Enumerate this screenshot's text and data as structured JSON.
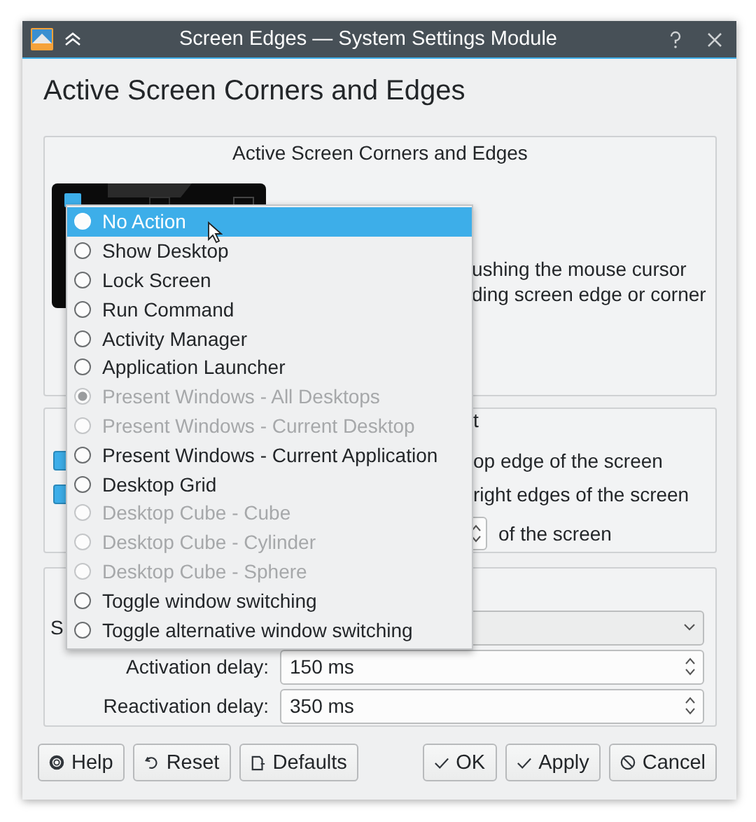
{
  "window": {
    "title": "Screen Edges — System Settings Module"
  },
  "heading": "Active Screen Corners and Edges",
  "edges_group": {
    "title": "Active Screen Corners and Edges",
    "description_lines": [
      "ushing the mouse cursor",
      "ding screen edge or corner"
    ]
  },
  "behavior_group": {
    "title": "t",
    "options": [
      {
        "label": "op edge of the screen",
        "checked": true
      },
      {
        "label": "right edges of the screen",
        "checked": true
      }
    ],
    "threshold_suffix": "of the screen"
  },
  "switching_group": {
    "label": "S",
    "fields": [
      {
        "label": "Activation delay:",
        "value": "150 ms"
      },
      {
        "label": "Reactivation delay:",
        "value": "350 ms"
      }
    ]
  },
  "left_buttons": [
    "Help",
    "Reset",
    "Defaults"
  ],
  "right_buttons": [
    "OK",
    "Apply",
    "Cancel"
  ],
  "action_menu": {
    "items": [
      {
        "label": "No Action",
        "selected": true,
        "checked": false,
        "disabled": false
      },
      {
        "label": "Show Desktop",
        "selected": false,
        "checked": false,
        "disabled": false
      },
      {
        "label": "Lock Screen",
        "selected": false,
        "checked": false,
        "disabled": false
      },
      {
        "label": "Run Command",
        "selected": false,
        "checked": false,
        "disabled": false
      },
      {
        "label": "Activity Manager",
        "selected": false,
        "checked": false,
        "disabled": false
      },
      {
        "label": "Application Launcher",
        "selected": false,
        "checked": false,
        "disabled": false
      },
      {
        "label": "Present Windows - All Desktops",
        "selected": false,
        "checked": true,
        "disabled": true
      },
      {
        "label": "Present Windows - Current Desktop",
        "selected": false,
        "checked": false,
        "disabled": true
      },
      {
        "label": "Present Windows - Current Application",
        "selected": false,
        "checked": false,
        "disabled": false
      },
      {
        "label": "Desktop Grid",
        "selected": false,
        "checked": false,
        "disabled": false
      },
      {
        "label": "Desktop Cube - Cube",
        "selected": false,
        "checked": false,
        "disabled": true
      },
      {
        "label": "Desktop Cube - Cylinder",
        "selected": false,
        "checked": false,
        "disabled": true
      },
      {
        "label": "Desktop Cube - Sphere",
        "selected": false,
        "checked": false,
        "disabled": true
      },
      {
        "label": "Toggle window switching",
        "selected": false,
        "checked": false,
        "disabled": false
      },
      {
        "label": "Toggle alternative window switching",
        "selected": false,
        "checked": false,
        "disabled": false
      }
    ]
  }
}
